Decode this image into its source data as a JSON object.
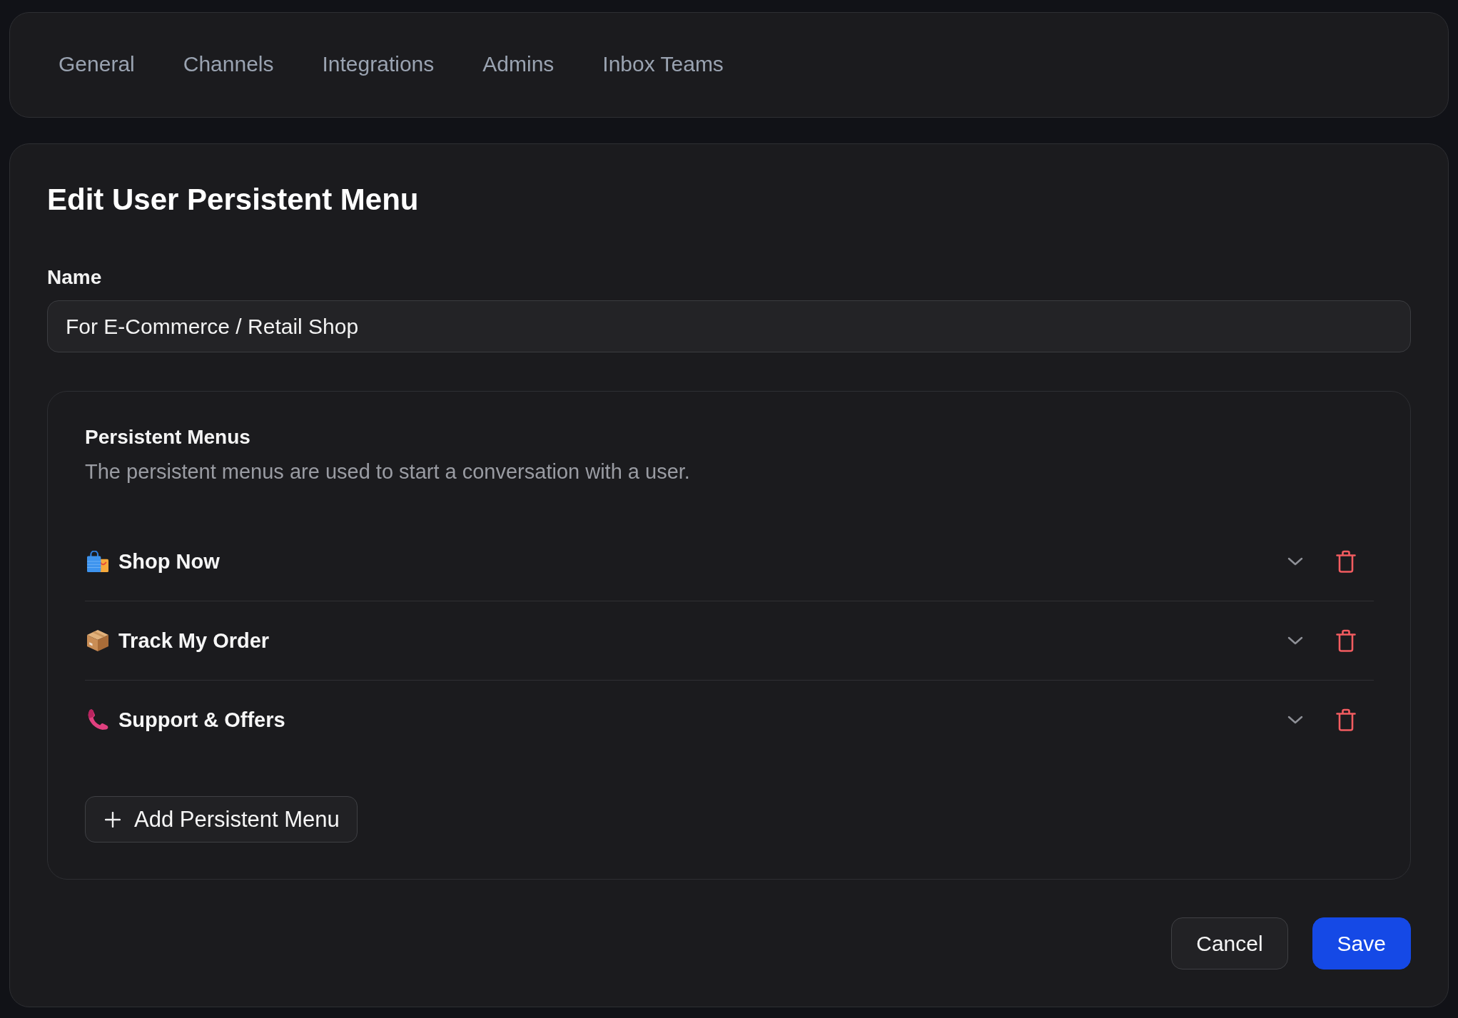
{
  "tabs": [
    {
      "label": "General",
      "selected": false
    },
    {
      "label": "Channels",
      "selected": false
    },
    {
      "label": "Integrations",
      "selected": false
    },
    {
      "label": "Admins",
      "selected": false
    },
    {
      "label": "Inbox Teams",
      "selected": false
    }
  ],
  "form": {
    "title": "Edit User Persistent Menu",
    "name_field": {
      "label": "Name",
      "value": "For E-Commerce / Retail Shop"
    },
    "persistent_menus": {
      "title": "Persistent Menus",
      "description": "The persistent menus are used to start a conversation with a user.",
      "items": [
        {
          "label": "Shop Now",
          "expanded": false
        },
        {
          "label": "Track My Order",
          "expanded": false
        },
        {
          "label": "Support & Offers",
          "expanded": false
        }
      ],
      "add_button": "Add Persistent Menu"
    },
    "buttons": [
      {
        "label": "Cancel",
        "kind": "secondary"
      },
      {
        "label": "Save",
        "kind": "primary"
      }
    ]
  }
}
